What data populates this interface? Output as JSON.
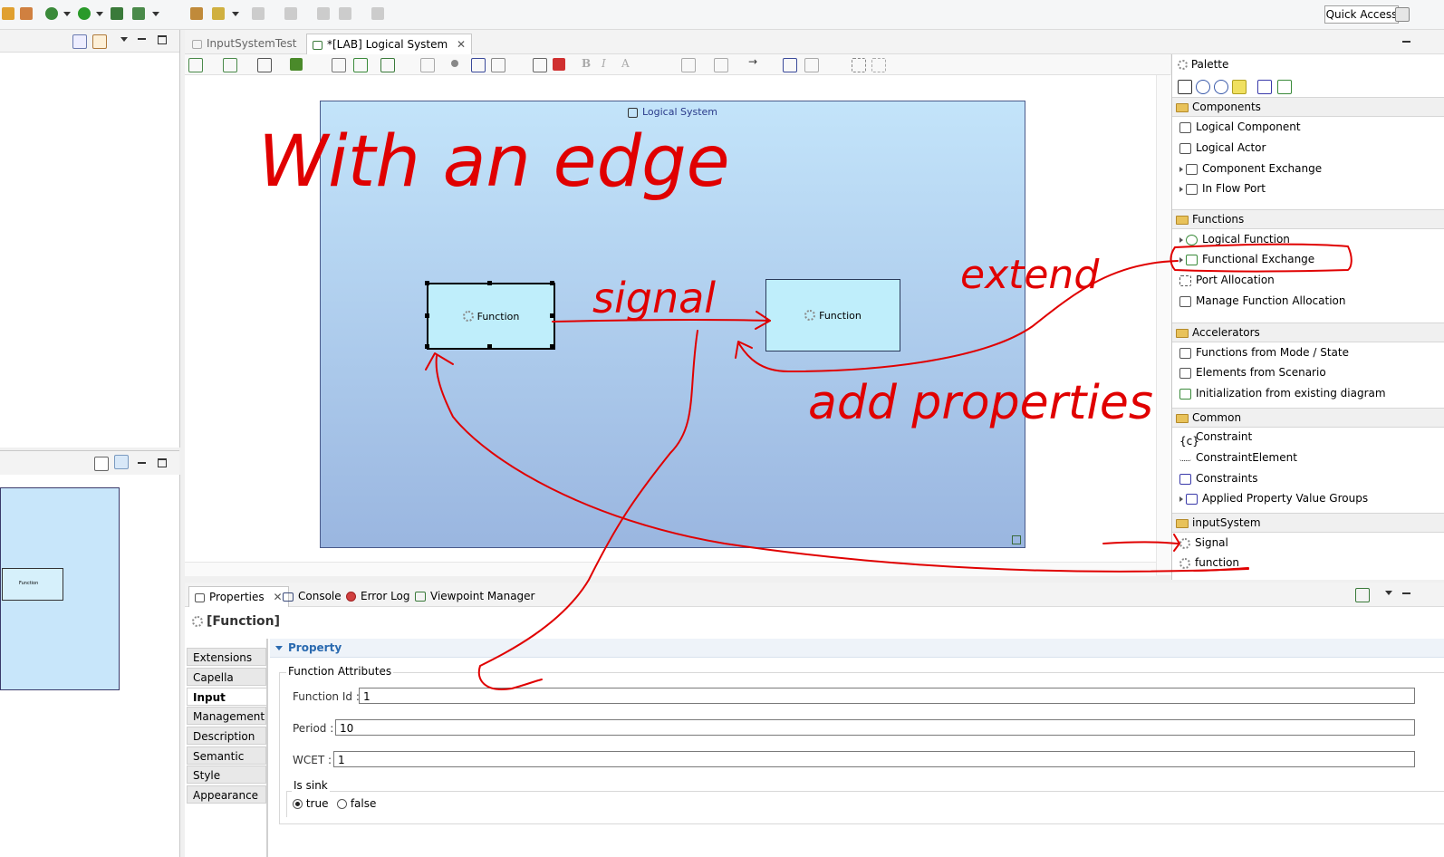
{
  "toolbar": {
    "quick_access": "Quick Access"
  },
  "editor": {
    "tabs": [
      {
        "label": "InputSystemTest"
      },
      {
        "label": "*[LAB] Logical System"
      }
    ],
    "diagram": {
      "container_label": "Logical System",
      "function_left": "Function",
      "function_right": "Function"
    }
  },
  "outline": {
    "mini_label": "Function"
  },
  "palette": {
    "title": "Palette",
    "sections": {
      "components": {
        "title": "Components",
        "items": [
          "Logical Component",
          "Logical Actor",
          "Component Exchange",
          "In Flow Port"
        ]
      },
      "functions": {
        "title": "Functions",
        "items": [
          "Logical Function",
          "Functional Exchange",
          "Port Allocation",
          "Manage Function Allocation"
        ]
      },
      "accelerators": {
        "title": "Accelerators",
        "items": [
          "Functions from Mode / State",
          "Elements from Scenario",
          "Initialization from existing diagram"
        ]
      },
      "common": {
        "title": "Common",
        "items": [
          "Constraint",
          "ConstraintElement",
          "Constraints",
          "Applied Property Value Groups"
        ]
      },
      "inputsystem": {
        "title": "inputSystem",
        "items": [
          "Signal",
          "function"
        ]
      }
    }
  },
  "properties": {
    "tabs": [
      "Properties",
      "Console",
      "Error Log",
      "Viewpoint Manager"
    ],
    "title": "[Function]",
    "side_tabs": [
      "Extensions",
      "Capella",
      "Input System",
      "Management",
      "Description",
      "Semantic",
      "Style",
      "Appearance"
    ],
    "section": "Property",
    "group_label": "Function Attributes",
    "fields": {
      "function_id": {
        "label": "Function Id :",
        "value": "1"
      },
      "period": {
        "label": "Period :",
        "value": "10"
      },
      "wcet": {
        "label": "WCET :",
        "value": "1"
      }
    },
    "is_sink": {
      "label": "Is sink",
      "options": [
        "true",
        "false"
      ],
      "selected": "true"
    }
  },
  "annotations": {
    "with_an_edge": "With an edge",
    "signal": "signal",
    "extend": "extend",
    "add_properties": "add properties",
    "color": "#e00000"
  }
}
